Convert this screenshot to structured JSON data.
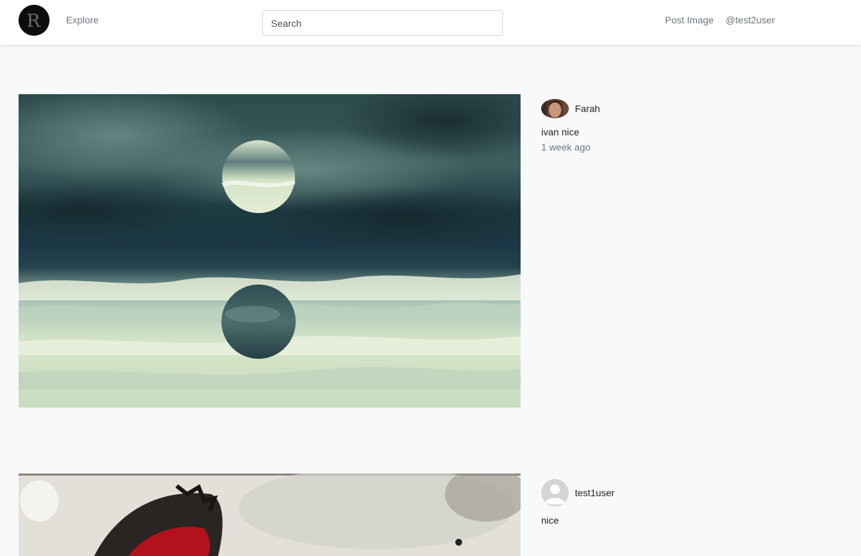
{
  "navbar": {
    "logo_letter": "R",
    "explore_label": "Explore",
    "search_placeholder": "Search",
    "post_image_label": "Post Image",
    "username_label": "@test2user"
  },
  "posts": [
    {
      "author": "Farah",
      "caption": "ivan nice",
      "time": "1 week ago",
      "image": "ocean-waves-circles-photo"
    },
    {
      "author": "test1user",
      "caption": "nice",
      "time": "",
      "image": "red-ornament-collage-photo"
    }
  ]
}
